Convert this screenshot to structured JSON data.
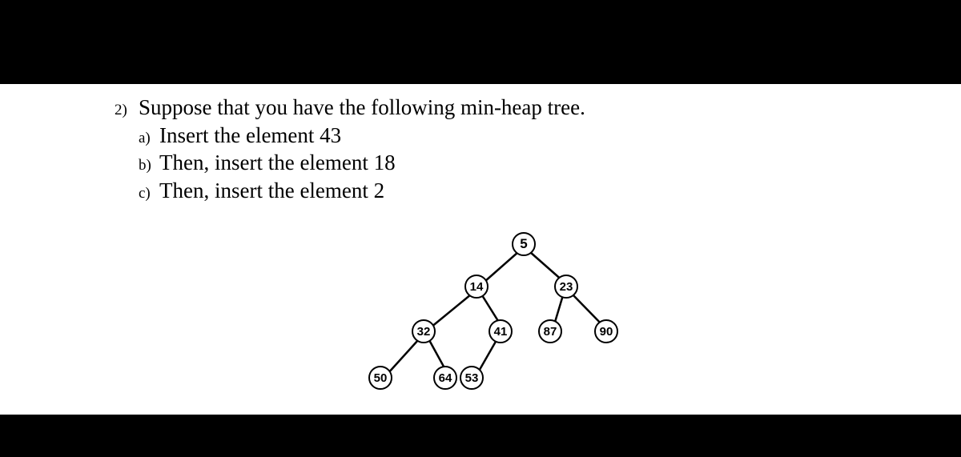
{
  "question": {
    "number": "2)",
    "prompt": "Suppose that you have the following min-heap tree.",
    "parts": [
      {
        "label": "a)",
        "text": "Insert the element 43"
      },
      {
        "label": "b)",
        "text": "Then, insert the element 18"
      },
      {
        "label": "c)",
        "text": "Then, insert the element 2"
      }
    ]
  },
  "tree": {
    "root": "5",
    "l1_left": "14",
    "l1_right": "23",
    "l2_a": "32",
    "l2_b": "41",
    "l2_c": "87",
    "l2_d": "90",
    "l3_a": "50",
    "l3_b": "64",
    "l3_c": "53"
  },
  "chart_data": {
    "type": "tree",
    "description": "min-heap binary tree",
    "nodes": [
      {
        "id": "5",
        "children": [
          "14",
          "23"
        ]
      },
      {
        "id": "14",
        "children": [
          "32",
          "41"
        ]
      },
      {
        "id": "23",
        "children": [
          "87",
          "90"
        ]
      },
      {
        "id": "32",
        "children": [
          "50",
          "64"
        ]
      },
      {
        "id": "41",
        "children": [
          "53"
        ]
      },
      {
        "id": "87",
        "children": []
      },
      {
        "id": "90",
        "children": []
      },
      {
        "id": "50",
        "children": []
      },
      {
        "id": "64",
        "children": []
      },
      {
        "id": "53",
        "children": []
      }
    ]
  }
}
